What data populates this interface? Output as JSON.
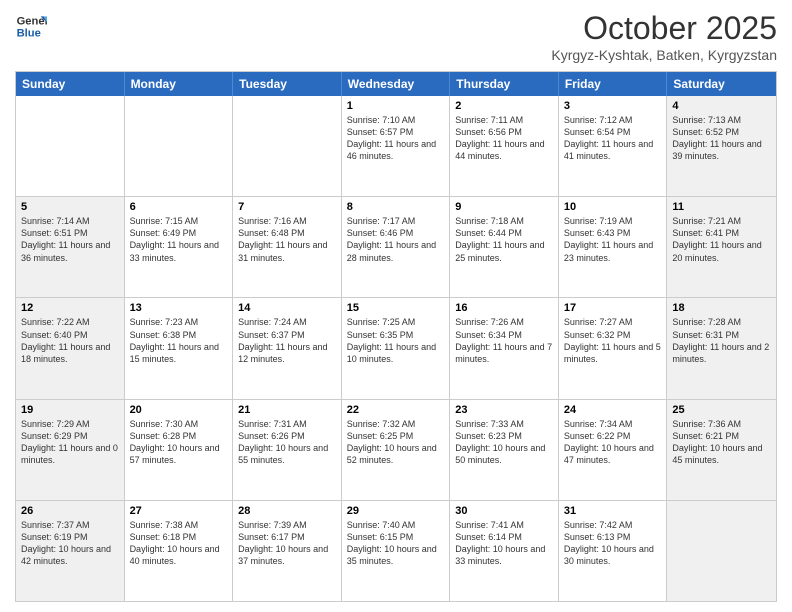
{
  "header": {
    "logo_line1": "General",
    "logo_line2": "Blue",
    "month": "October 2025",
    "location": "Kyrgyz-Kyshtak, Batken, Kyrgyzstan"
  },
  "days_of_week": [
    "Sunday",
    "Monday",
    "Tuesday",
    "Wednesday",
    "Thursday",
    "Friday",
    "Saturday"
  ],
  "weeks": [
    [
      {
        "day": "",
        "text": "",
        "shaded": false
      },
      {
        "day": "",
        "text": "",
        "shaded": false
      },
      {
        "day": "",
        "text": "",
        "shaded": false
      },
      {
        "day": "1",
        "text": "Sunrise: 7:10 AM\nSunset: 6:57 PM\nDaylight: 11 hours and 46 minutes.",
        "shaded": false
      },
      {
        "day": "2",
        "text": "Sunrise: 7:11 AM\nSunset: 6:56 PM\nDaylight: 11 hours and 44 minutes.",
        "shaded": false
      },
      {
        "day": "3",
        "text": "Sunrise: 7:12 AM\nSunset: 6:54 PM\nDaylight: 11 hours and 41 minutes.",
        "shaded": false
      },
      {
        "day": "4",
        "text": "Sunrise: 7:13 AM\nSunset: 6:52 PM\nDaylight: 11 hours and 39 minutes.",
        "shaded": true
      }
    ],
    [
      {
        "day": "5",
        "text": "Sunrise: 7:14 AM\nSunset: 6:51 PM\nDaylight: 11 hours and 36 minutes.",
        "shaded": true
      },
      {
        "day": "6",
        "text": "Sunrise: 7:15 AM\nSunset: 6:49 PM\nDaylight: 11 hours and 33 minutes.",
        "shaded": false
      },
      {
        "day": "7",
        "text": "Sunrise: 7:16 AM\nSunset: 6:48 PM\nDaylight: 11 hours and 31 minutes.",
        "shaded": false
      },
      {
        "day": "8",
        "text": "Sunrise: 7:17 AM\nSunset: 6:46 PM\nDaylight: 11 hours and 28 minutes.",
        "shaded": false
      },
      {
        "day": "9",
        "text": "Sunrise: 7:18 AM\nSunset: 6:44 PM\nDaylight: 11 hours and 25 minutes.",
        "shaded": false
      },
      {
        "day": "10",
        "text": "Sunrise: 7:19 AM\nSunset: 6:43 PM\nDaylight: 11 hours and 23 minutes.",
        "shaded": false
      },
      {
        "day": "11",
        "text": "Sunrise: 7:21 AM\nSunset: 6:41 PM\nDaylight: 11 hours and 20 minutes.",
        "shaded": true
      }
    ],
    [
      {
        "day": "12",
        "text": "Sunrise: 7:22 AM\nSunset: 6:40 PM\nDaylight: 11 hours and 18 minutes.",
        "shaded": true
      },
      {
        "day": "13",
        "text": "Sunrise: 7:23 AM\nSunset: 6:38 PM\nDaylight: 11 hours and 15 minutes.",
        "shaded": false
      },
      {
        "day": "14",
        "text": "Sunrise: 7:24 AM\nSunset: 6:37 PM\nDaylight: 11 hours and 12 minutes.",
        "shaded": false
      },
      {
        "day": "15",
        "text": "Sunrise: 7:25 AM\nSunset: 6:35 PM\nDaylight: 11 hours and 10 minutes.",
        "shaded": false
      },
      {
        "day": "16",
        "text": "Sunrise: 7:26 AM\nSunset: 6:34 PM\nDaylight: 11 hours and 7 minutes.",
        "shaded": false
      },
      {
        "day": "17",
        "text": "Sunrise: 7:27 AM\nSunset: 6:32 PM\nDaylight: 11 hours and 5 minutes.",
        "shaded": false
      },
      {
        "day": "18",
        "text": "Sunrise: 7:28 AM\nSunset: 6:31 PM\nDaylight: 11 hours and 2 minutes.",
        "shaded": true
      }
    ],
    [
      {
        "day": "19",
        "text": "Sunrise: 7:29 AM\nSunset: 6:29 PM\nDaylight: 11 hours and 0 minutes.",
        "shaded": true
      },
      {
        "day": "20",
        "text": "Sunrise: 7:30 AM\nSunset: 6:28 PM\nDaylight: 10 hours and 57 minutes.",
        "shaded": false
      },
      {
        "day": "21",
        "text": "Sunrise: 7:31 AM\nSunset: 6:26 PM\nDaylight: 10 hours and 55 minutes.",
        "shaded": false
      },
      {
        "day": "22",
        "text": "Sunrise: 7:32 AM\nSunset: 6:25 PM\nDaylight: 10 hours and 52 minutes.",
        "shaded": false
      },
      {
        "day": "23",
        "text": "Sunrise: 7:33 AM\nSunset: 6:23 PM\nDaylight: 10 hours and 50 minutes.",
        "shaded": false
      },
      {
        "day": "24",
        "text": "Sunrise: 7:34 AM\nSunset: 6:22 PM\nDaylight: 10 hours and 47 minutes.",
        "shaded": false
      },
      {
        "day": "25",
        "text": "Sunrise: 7:36 AM\nSunset: 6:21 PM\nDaylight: 10 hours and 45 minutes.",
        "shaded": true
      }
    ],
    [
      {
        "day": "26",
        "text": "Sunrise: 7:37 AM\nSunset: 6:19 PM\nDaylight: 10 hours and 42 minutes.",
        "shaded": true
      },
      {
        "day": "27",
        "text": "Sunrise: 7:38 AM\nSunset: 6:18 PM\nDaylight: 10 hours and 40 minutes.",
        "shaded": false
      },
      {
        "day": "28",
        "text": "Sunrise: 7:39 AM\nSunset: 6:17 PM\nDaylight: 10 hours and 37 minutes.",
        "shaded": false
      },
      {
        "day": "29",
        "text": "Sunrise: 7:40 AM\nSunset: 6:15 PM\nDaylight: 10 hours and 35 minutes.",
        "shaded": false
      },
      {
        "day": "30",
        "text": "Sunrise: 7:41 AM\nSunset: 6:14 PM\nDaylight: 10 hours and 33 minutes.",
        "shaded": false
      },
      {
        "day": "31",
        "text": "Sunrise: 7:42 AM\nSunset: 6:13 PM\nDaylight: 10 hours and 30 minutes.",
        "shaded": false
      },
      {
        "day": "",
        "text": "",
        "shaded": true
      }
    ]
  ]
}
